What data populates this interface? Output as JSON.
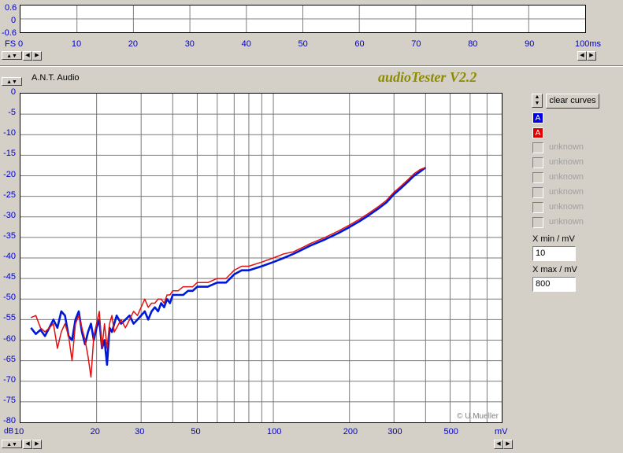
{
  "top_panel": {
    "y_ticks": [
      "0.6",
      "0",
      "-0.6"
    ],
    "x_unit_label": "FS",
    "x_ticks": [
      "0",
      "10",
      "20",
      "30",
      "40",
      "50",
      "60",
      "70",
      "80",
      "90",
      "100ms"
    ]
  },
  "app": {
    "brand": "A.N.T. Audio",
    "title": "audioTester V2.2",
    "copyright": "© U.Mueller"
  },
  "controls": {
    "clear_curves": "clear curves",
    "channel_a_blue": "A",
    "channel_a_red": "A",
    "unknown_items": [
      "unknown",
      "unknown",
      "unknown",
      "unknown",
      "unknown",
      "unknown"
    ],
    "xmin_label": "X min / mV",
    "xmin_value": "10",
    "xmax_label": "X max / mV",
    "xmax_value": "800"
  },
  "colors": {
    "series_blue": "#0018d8",
    "series_red": "#e01010",
    "title": "#8c8c00",
    "axis_text": "#0000c8"
  },
  "chart_data": {
    "type": "line",
    "x_scale": "log",
    "xlim": [
      10,
      800
    ],
    "ylim": [
      -80,
      0
    ],
    "x_ticks": [
      "10",
      "20",
      "30",
      "50",
      "100",
      "200",
      "300",
      "500"
    ],
    "x_unit": "mV",
    "y_ticks": [
      "0",
      "-5",
      "-10",
      "-15",
      "-20",
      "-25",
      "-30",
      "-35",
      "-40",
      "-45",
      "-50",
      "-55",
      "-60",
      "-65",
      "-70",
      "-75",
      "-80"
    ],
    "y_unit": "dB",
    "grid": true,
    "series": [
      {
        "color": "blue",
        "x": [
          11,
          11.5,
          12,
          12.5,
          13,
          13.5,
          14,
          14.5,
          15,
          15.5,
          16,
          16.5,
          17,
          17.5,
          18,
          18.5,
          19,
          19.5,
          20,
          20.5,
          21,
          21.5,
          22,
          22.5,
          23,
          23.5,
          24,
          25,
          26,
          27,
          28,
          29,
          30,
          31,
          32,
          33,
          34,
          35,
          36,
          37,
          38,
          39,
          40,
          42,
          44,
          46,
          48,
          50,
          55,
          60,
          65,
          70,
          75,
          80,
          90,
          100,
          110,
          120,
          130,
          140,
          160,
          180,
          200,
          220,
          240,
          260,
          280,
          300,
          320,
          340,
          360,
          380,
          400
        ],
        "y": [
          -57,
          -58.5,
          -57.5,
          -59,
          -57,
          -55,
          -57,
          -53,
          -54,
          -59,
          -60,
          -55,
          -53,
          -58,
          -61,
          -58,
          -56,
          -60,
          -57,
          -55,
          -62,
          -60,
          -66,
          -57,
          -58,
          -56,
          -54,
          -56,
          -55,
          -54,
          -56,
          -55,
          -54,
          -53,
          -55,
          -53,
          -52,
          -53,
          -51,
          -52,
          -50,
          -51,
          -49,
          -49,
          -49,
          -48,
          -48,
          -47,
          -47,
          -46,
          -46,
          -44,
          -43,
          -43,
          -42,
          -41,
          -40,
          -39,
          -38,
          -37,
          -35.5,
          -34,
          -32.5,
          -31,
          -29.5,
          -28,
          -26.5,
          -24.5,
          -23,
          -21.5,
          -20,
          -19,
          -18
        ]
      },
      {
        "color": "red",
        "x": [
          11,
          11.5,
          12,
          12.5,
          13,
          13.5,
          14,
          14.5,
          15,
          15.5,
          16,
          16.5,
          17,
          17.5,
          18,
          18.5,
          19,
          19.5,
          20,
          20.5,
          21,
          21.5,
          22,
          22.5,
          23,
          23.5,
          24,
          25,
          26,
          27,
          28,
          29,
          30,
          31,
          32,
          33,
          34,
          35,
          36,
          37,
          38,
          39,
          40,
          42,
          44,
          46,
          48,
          50,
          55,
          60,
          65,
          70,
          75,
          80,
          90,
          100,
          110,
          120,
          130,
          140,
          160,
          180,
          200,
          220,
          240,
          260,
          280,
          300,
          320,
          340,
          360,
          380,
          400
        ],
        "y": [
          -54.5,
          -54,
          -57,
          -58,
          -57,
          -56,
          -62,
          -58,
          -56,
          -59,
          -65,
          -56,
          -54,
          -57,
          -60,
          -64,
          -69,
          -59,
          -56,
          -53,
          -62,
          -56,
          -62,
          -56,
          -54,
          -58,
          -57,
          -55,
          -57,
          -55,
          -53,
          -54,
          -52,
          -50,
          -52,
          -51,
          -51,
          -50,
          -50,
          -51,
          -49,
          -49,
          -48,
          -48,
          -47,
          -47,
          -47,
          -46,
          -46,
          -45,
          -45,
          -43,
          -42,
          -42,
          -41,
          -40,
          -39,
          -38.5,
          -37.5,
          -36.5,
          -35,
          -33.5,
          -32,
          -30.5,
          -29,
          -27.5,
          -26,
          -24,
          -22.5,
          -21,
          -19.5,
          -18.5,
          -18
        ]
      }
    ]
  }
}
